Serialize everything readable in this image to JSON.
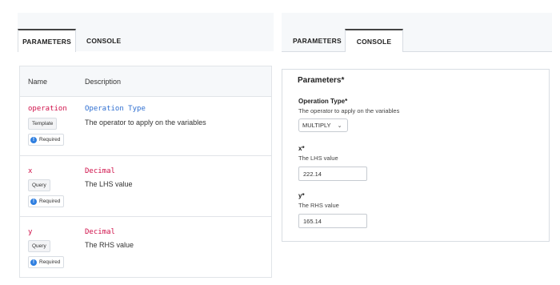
{
  "left_panel": {
    "tabs": [
      {
        "label": "PARAMETERS",
        "active": true
      },
      {
        "label": "CONSOLE",
        "active": false
      }
    ],
    "table": {
      "headers": [
        "Name",
        "Description"
      ],
      "rows": [
        {
          "name": "operation",
          "type": "Operation Type",
          "type_color": "#2f6fd1",
          "location": "Template",
          "required": "Required",
          "description": "The operator to apply on the variables"
        },
        {
          "name": "x",
          "type": "Decimal",
          "type_color": "#d0114a",
          "location": "Query",
          "required": "Required",
          "description": "The LHS value"
        },
        {
          "name": "y",
          "type": "Decimal",
          "type_color": "#d0114a",
          "location": "Query",
          "required": "Required",
          "description": "The RHS value"
        }
      ]
    }
  },
  "right_panel": {
    "tabs": [
      {
        "label": "PARAMETERS",
        "active": false
      },
      {
        "label": "CONSOLE",
        "active": true
      }
    ],
    "form": {
      "legend": "Parameters*",
      "operation": {
        "label": "Operation Type*",
        "description": "The operator to apply on the variables",
        "value": "MULTIPLY"
      },
      "x": {
        "label": "x*",
        "description": "The LHS value",
        "value": "222.14"
      },
      "y": {
        "label": "y*",
        "description": "The RHS value",
        "value": "165.14"
      }
    }
  },
  "icons": {
    "required": "info-icon",
    "select": "chevron-down-icon"
  }
}
